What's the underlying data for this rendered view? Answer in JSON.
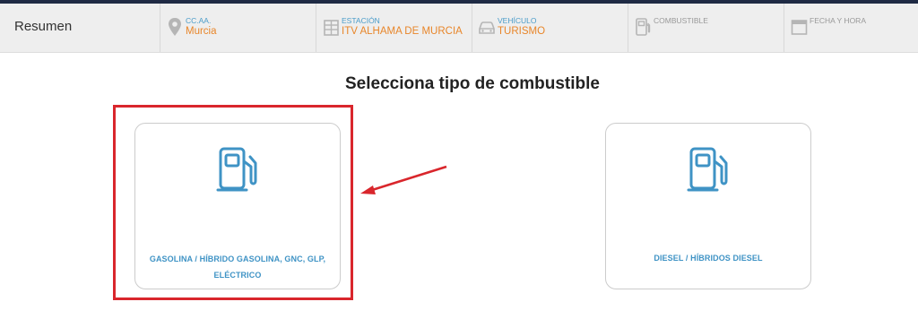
{
  "summary": {
    "title": "Resumen",
    "steps": [
      {
        "label": "CC.AA.",
        "value": "Murcia",
        "icon": "location-pin-icon",
        "active": true
      },
      {
        "label": "ESTACIÓN",
        "value": "ITV ALHAMA DE MURCIA",
        "icon": "building-icon",
        "active": true
      },
      {
        "label": "VEHÍCULO",
        "value": "TURISMO",
        "icon": "car-icon",
        "active": true
      },
      {
        "label": "COMBUSTIBLE",
        "value": "",
        "icon": "fuel-pump-icon",
        "active": false
      },
      {
        "label": "FECHA Y HORA",
        "value": "",
        "icon": "calendar-icon",
        "active": false
      }
    ]
  },
  "main": {
    "heading": "Selecciona tipo de combustible",
    "options": [
      {
        "line1": "GASOLINA / HÍBRIDO GASOLINA, GNC, GLP,",
        "line2": "ELÉCTRICO",
        "icon": "fuel-pump-icon"
      },
      {
        "line1": "DIESEL / HÍBRIDOS DIESEL",
        "icon": "fuel-pump-icon"
      }
    ]
  },
  "annotation": {
    "highlight_color": "#d9262c"
  },
  "colors": {
    "accent": "#3f93c5",
    "value_orange": "#e8862a",
    "top_border": "#1f2a44"
  }
}
